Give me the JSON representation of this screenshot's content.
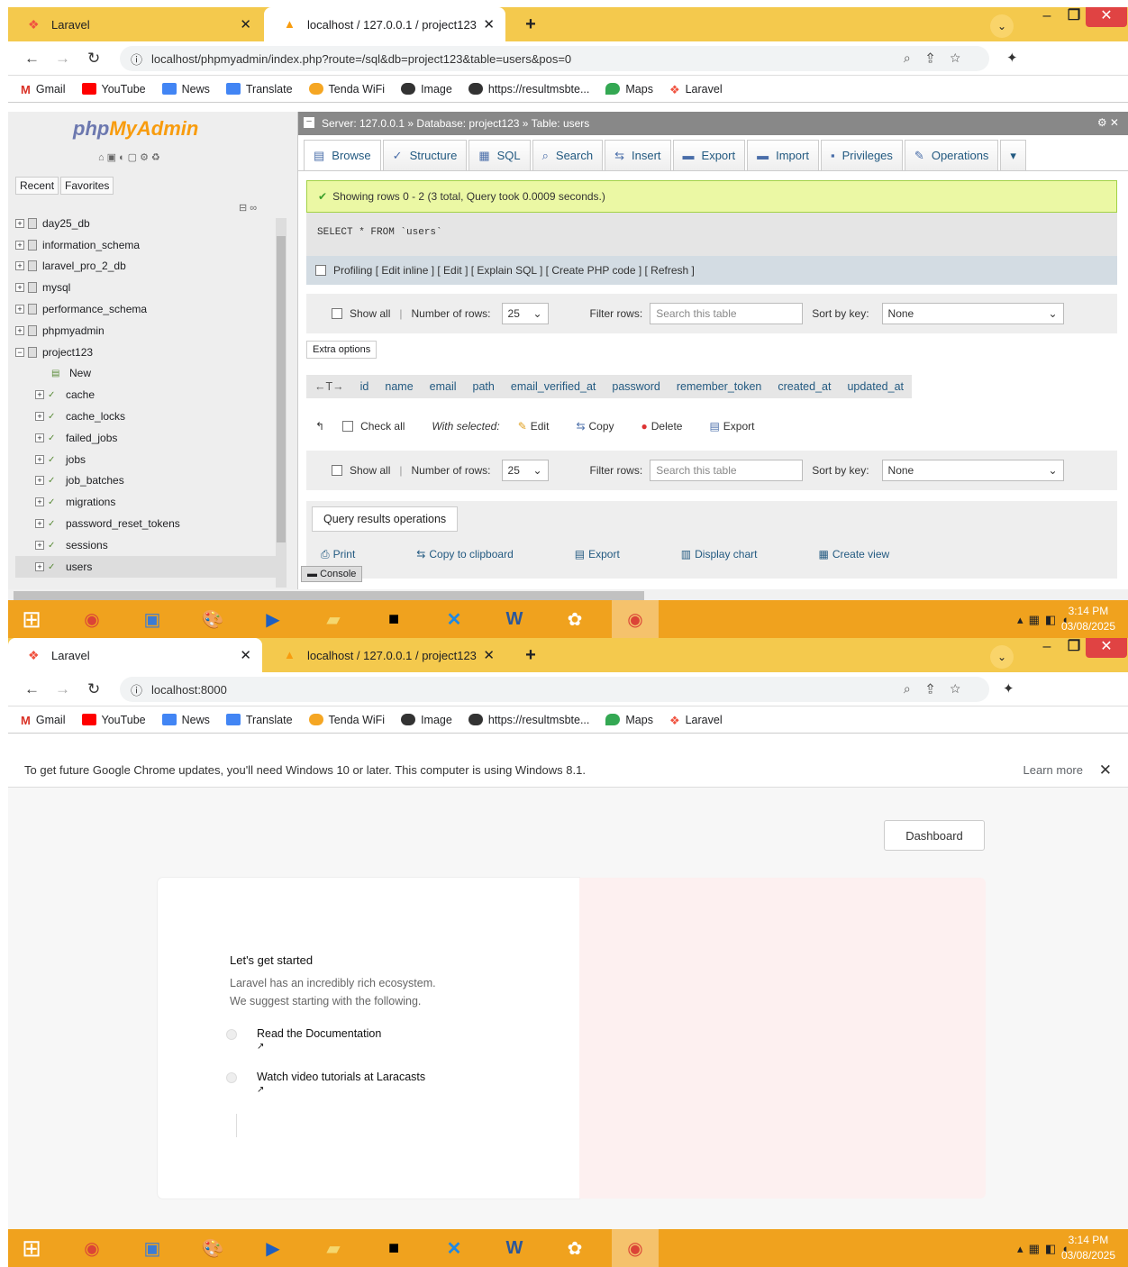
{
  "browser_top": {
    "tabs": [
      {
        "label": "Laravel"
      },
      {
        "label": "localhost / 127.0.0.1 / project123"
      }
    ],
    "url": "localhost/phpmyadmin/index.php?route=/sql&db=project123&table=users&pos=0"
  },
  "browser_bottom": {
    "tabs": [
      {
        "label": "Laravel"
      },
      {
        "label": "localhost / 127.0.0.1 / project123"
      }
    ],
    "url": "localhost:8000"
  },
  "bookmarks": [
    "Gmail",
    "YouTube",
    "News",
    "Translate",
    "Tenda WiFi",
    "Image",
    "https://resultmsbte...",
    "Maps",
    "Laravel"
  ],
  "pma": {
    "logo_a": "php",
    "logo_b": "MyAdmin",
    "nav_tabs": [
      "Recent",
      "Favorites"
    ],
    "tree": [
      {
        "label": "day25_db",
        "type": "db"
      },
      {
        "label": "information_schema",
        "type": "db"
      },
      {
        "label": "laravel_pro_2_db",
        "type": "db"
      },
      {
        "label": "mysql",
        "type": "db"
      },
      {
        "label": "performance_schema",
        "type": "db"
      },
      {
        "label": "phpmyadmin",
        "type": "db"
      },
      {
        "label": "project123",
        "type": "db-open"
      },
      {
        "label": "New",
        "type": "new"
      },
      {
        "label": "cache",
        "type": "table"
      },
      {
        "label": "cache_locks",
        "type": "table"
      },
      {
        "label": "failed_jobs",
        "type": "table"
      },
      {
        "label": "jobs",
        "type": "table"
      },
      {
        "label": "job_batches",
        "type": "table"
      },
      {
        "label": "migrations",
        "type": "table"
      },
      {
        "label": "password_reset_tokens",
        "type": "table"
      },
      {
        "label": "sessions",
        "type": "table"
      },
      {
        "label": "users",
        "type": "table"
      }
    ],
    "breadcrumb": "Server: 127.0.0.1 » Database: project123 » Table: users",
    "menu": [
      "Browse",
      "Structure",
      "SQL",
      "Search",
      "Insert",
      "Export",
      "Import",
      "Privileges",
      "Operations"
    ],
    "success": "Showing rows 0 - 2 (3 total, Query took 0.0009 seconds.)",
    "sql": "SELECT * FROM `users`",
    "profiling": "Profiling [ Edit inline ] [ Edit ] [ Explain SQL ] [ Create PHP code ] [ Refresh ]",
    "show_all": "Show all",
    "num_rows_label": "Number of rows:",
    "num_rows": "25",
    "filter_label": "Filter rows:",
    "filter_placeholder": "Search this table",
    "sort_label": "Sort by key:",
    "sort_value": "None",
    "extra_options": "Extra options",
    "columns": [
      "id",
      "name",
      "email",
      "path",
      "email_verified_at",
      "password",
      "remember_token",
      "created_at",
      "updated_at"
    ],
    "check_all": "Check all",
    "with_selected": "With selected:",
    "actions": [
      "Edit",
      "Copy",
      "Delete",
      "Export"
    ],
    "qro_title": "Query results operations",
    "qro_items": [
      "Print",
      "Copy to clipboard",
      "Export",
      "Display chart",
      "Create view"
    ],
    "console": "Console"
  },
  "taskbar": {
    "time": "3:14 PM",
    "date": "03/08/2025"
  },
  "chrome_banner": {
    "text": "To get future Google Chrome updates, you'll need Windows 10 or later. This computer is using Windows 8.1.",
    "learn_more": "Learn more"
  },
  "laravel": {
    "dashboard": "Dashboard",
    "heading": "Let's get started",
    "p1": "Laravel has an incredibly rich ecosystem.",
    "p2": "We suggest starting with the following.",
    "step1": "Read the Documentation",
    "step2": "Watch video tutorials at Laracasts"
  }
}
